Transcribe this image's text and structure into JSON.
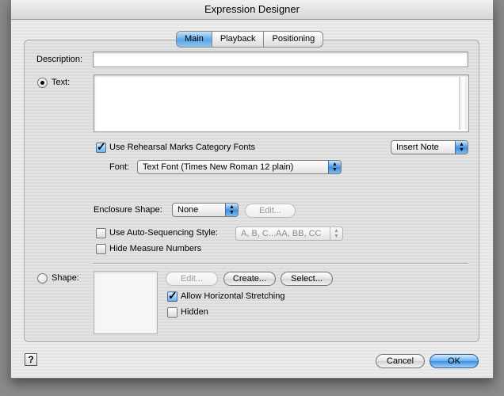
{
  "window": {
    "title": "Expression Designer"
  },
  "tabs": [
    {
      "label": "Main",
      "selected": true
    },
    {
      "label": "Playback",
      "selected": false
    },
    {
      "label": "Positioning",
      "selected": false
    }
  ],
  "description": {
    "label": "Description:",
    "value": ""
  },
  "text_mode": {
    "label": "Text:",
    "selected": true,
    "value": "",
    "use_rehearsal_fonts": {
      "label": "Use Rehearsal Marks Category Fonts",
      "checked": true
    },
    "insert_note": {
      "value": "Insert Note"
    },
    "font": {
      "label": "Font:",
      "value": "Text Font (Times New Roman 12 plain)"
    }
  },
  "enclosure": {
    "label": "Enclosure Shape:",
    "value": "None",
    "edit_label": "Edit..."
  },
  "auto_sequencing": {
    "label": "Use Auto-Sequencing Style:",
    "checked": false,
    "value": "A, B, C...AA, BB, CC"
  },
  "hide_measure_numbers": {
    "label": "Hide Measure Numbers",
    "checked": false
  },
  "shape_mode": {
    "label": "Shape:",
    "selected": false,
    "edit_label": "Edit...",
    "create_label": "Create...",
    "select_label": "Select...",
    "allow_horizontal_stretching": {
      "label": "Allow Horizontal Stretching",
      "checked": true
    },
    "hidden": {
      "label": "Hidden",
      "checked": false
    }
  },
  "footer": {
    "help_glyph": "?",
    "cancel_label": "Cancel",
    "ok_label": "OK"
  },
  "icons": {
    "popup_arrows": "up-down-arrows-icon",
    "check": "checkmark-icon"
  },
  "colors": {
    "accent": "#3e8fe0",
    "tab_selected": "#5aa5e6"
  }
}
